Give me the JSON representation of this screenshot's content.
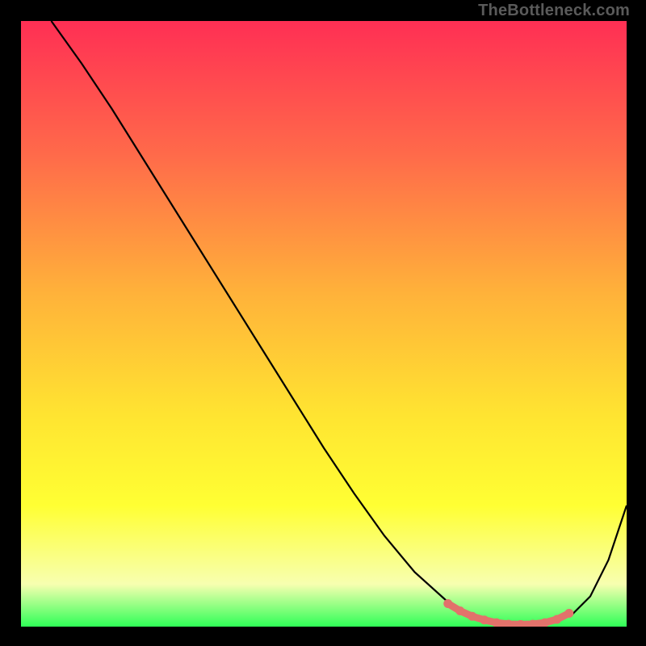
{
  "attribution": "TheBottleneck.com",
  "colors": {
    "bg": "#000000",
    "attribution_text": "#5a5a5a",
    "curve": "#000000",
    "marker_fill": "#e2726b",
    "grad_top": "#ff2f54",
    "grad_mid1": "#ff6a4a",
    "grad_mid2": "#ffb23a",
    "grad_mid3": "#ffe431",
    "grad_yellow": "#ffff33",
    "grad_pale": "#f7ffb0",
    "grad_green": "#2fff57"
  },
  "chart_data": {
    "type": "line",
    "title": "",
    "xlabel": "",
    "ylabel": "",
    "xlim": [
      0,
      100
    ],
    "ylim": [
      0,
      100
    ],
    "grid": false,
    "legend": false,
    "series": [
      {
        "name": "bottleneck-curve",
        "x": [
          5,
          10,
          15,
          20,
          25,
          30,
          35,
          40,
          45,
          50,
          55,
          60,
          65,
          70,
          73,
          76,
          79,
          82,
          85,
          88,
          91,
          94,
          97,
          100
        ],
        "y": [
          100,
          93,
          85.5,
          77.5,
          69.5,
          61.5,
          53.5,
          45.5,
          37.5,
          29.5,
          22,
          15,
          9,
          4.5,
          2.3,
          1.1,
          0.55,
          0.35,
          0.35,
          0.7,
          2,
          5,
          11,
          20
        ]
      }
    ],
    "optimal_markers": {
      "name": "optimal-zone",
      "x": [
        70.5,
        72.5,
        74.5,
        76.5,
        78.5,
        80.5,
        82.5,
        84.5,
        86.5,
        88.5,
        90.5
      ],
      "y": [
        3.8,
        2.6,
        1.7,
        1.1,
        0.65,
        0.4,
        0.35,
        0.4,
        0.65,
        1.2,
        2.2
      ]
    }
  }
}
